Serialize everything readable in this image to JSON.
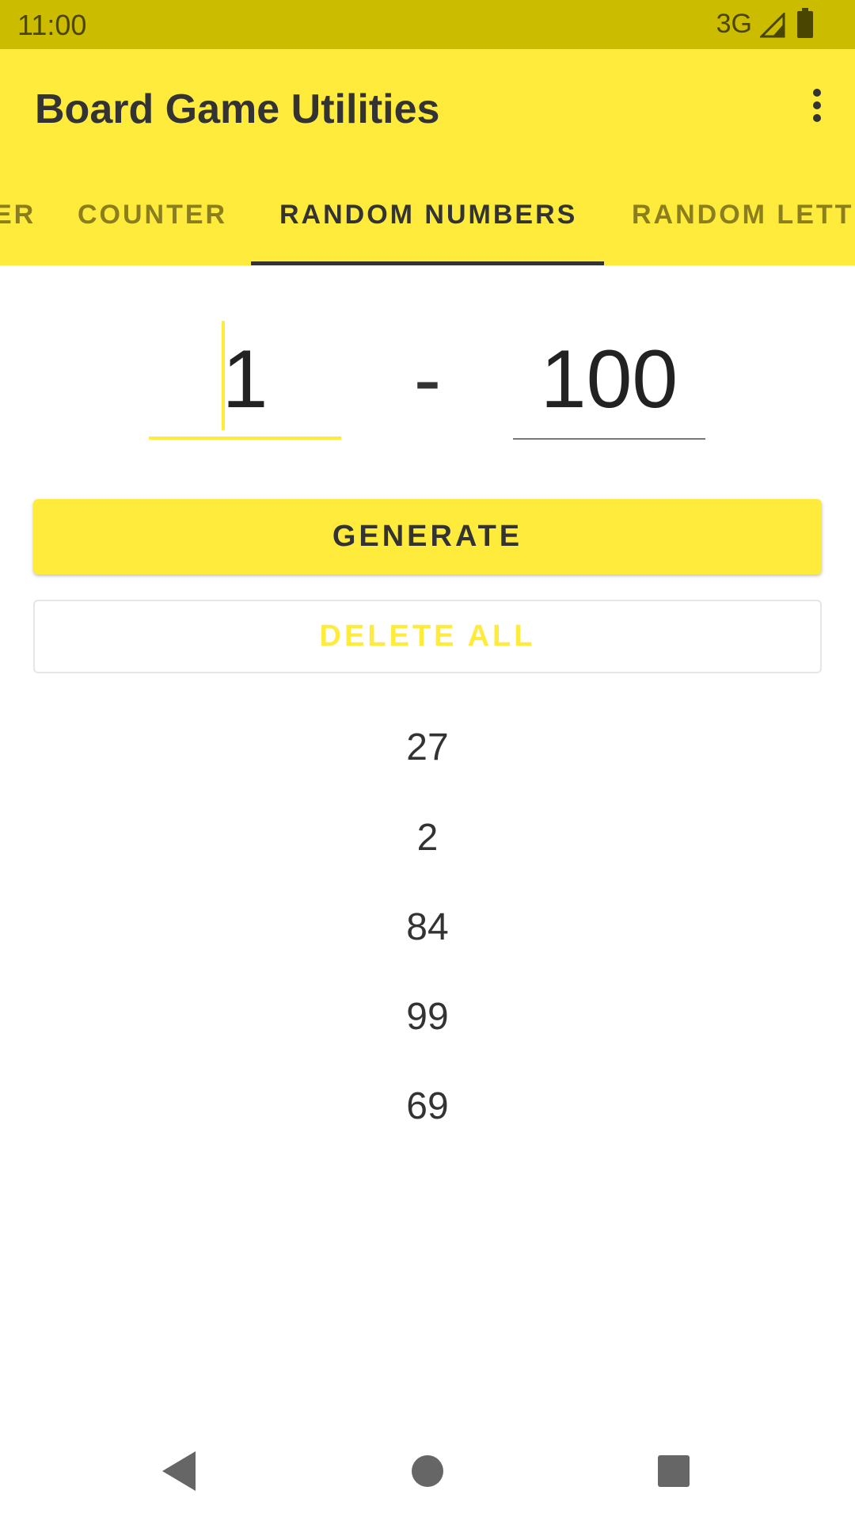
{
  "status_bar": {
    "time": "11:00",
    "network": "3G"
  },
  "app_bar": {
    "title": "Board Game Utilities",
    "menu_icon": "more-vert-icon"
  },
  "tabs": [
    {
      "label": "ER",
      "active": false
    },
    {
      "label": "COUNTER",
      "active": false
    },
    {
      "label": "RANDOM NUMBERS",
      "active": true
    },
    {
      "label": "RANDOM LETT",
      "active": false
    }
  ],
  "range": {
    "min": "1",
    "separator": "-",
    "max": "100"
  },
  "buttons": {
    "generate": "GENERATE",
    "delete_all": "DELETE ALL"
  },
  "results": [
    "27",
    "2",
    "84",
    "99",
    "69"
  ],
  "colors": {
    "primary": "#ffeb3b",
    "status_bar": "#cbbc00",
    "text": "#333333"
  },
  "nav_bar": {
    "back": "back-icon",
    "home": "home-icon",
    "recents": "recents-icon"
  }
}
